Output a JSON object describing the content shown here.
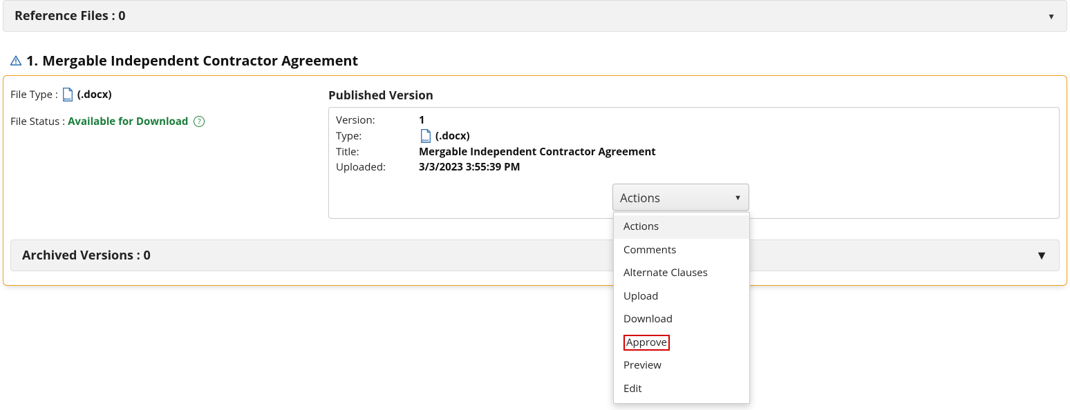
{
  "reference_files": {
    "label": "Reference Files :",
    "count": "0"
  },
  "document": {
    "title_prefix": "1.",
    "title": "Mergable Independent Contractor Agreement",
    "file_type_label": "File Type :",
    "file_type_ext": "(.docx)",
    "file_status_label": "File Status :",
    "file_status_value": "Available for Download",
    "help_glyph": "?",
    "published_version_label": "Published Version",
    "version": {
      "k": "Version:",
      "v": "1"
    },
    "type": {
      "k": "Type:",
      "v": "(.docx)"
    },
    "doc_title": {
      "k": "Title:",
      "v": "Mergable Independent Contractor Agreement"
    },
    "uploaded": {
      "k": "Uploaded:",
      "v": "3/3/2023 3:55:39 PM"
    }
  },
  "actions": {
    "button_label": "Actions",
    "items": [
      "Actions",
      "Comments",
      "Alternate Clauses",
      "Upload",
      "Download",
      "Approve",
      "Preview",
      "Edit"
    ],
    "highlighted_index": 5
  },
  "archived_versions": {
    "label": "Archived Versions :",
    "count": "0"
  }
}
